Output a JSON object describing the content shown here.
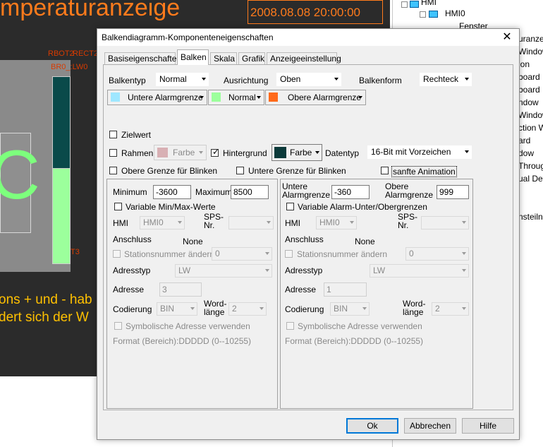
{
  "background_app": {
    "title": "mperaturanzeige",
    "datetime": "2008.08.08  20:00:00",
    "big_letter": "C",
    "red_labels": [
      "RBOT2",
      "RECT2",
      "BR0_:LW0",
      "T3"
    ],
    "yellow_text": [
      "ons + und - hab",
      "dert sich der W"
    ],
    "tree": {
      "hmi_root": "HMI",
      "hmi0": "HMI0",
      "fenster": "Fenster",
      "items": [
        "uranzeig",
        "Window",
        "ion",
        "board",
        "board",
        "ndow",
        "Window",
        "ction W",
        "ard",
        "dow",
        "Through",
        "ual Devi",
        "nsteilne"
      ]
    }
  },
  "dialog": {
    "title": "Balkendiagramm-Komponenteneigenschaften",
    "close_glyph": "✕",
    "tabs": [
      "Basiseigenschaften",
      "Balken",
      "Skala",
      "Grafik",
      "Anzeigeeinstellung"
    ],
    "active_tab": 1,
    "row1": {
      "balkentyp_label": "Balkentyp",
      "balkentyp_value": "Normal",
      "ausrichtung_label": "Ausrichtung",
      "ausrichtung_value": "Oben",
      "balkenform_label": "Balkenform",
      "balkenform_value": "Rechteck"
    },
    "colors": [
      {
        "label": "Untere Alarmgrenze",
        "color": "#9fe7ff"
      },
      {
        "label": "Normal",
        "color": "#9cff9c"
      },
      {
        "label": "Obere Alarmgrenze",
        "color": "#ff6a1a"
      }
    ],
    "zielwert": "Zielwert",
    "rahmen": "Rahmen",
    "rahmen_farbe": "Farbe",
    "rahmen_color": "#d8b0b4",
    "hintergrund": "Hintergrund",
    "hintergrund_farbe": "Farbe",
    "hintergrund_color": "#0b3a3a",
    "datentyp_label": "Datentyp",
    "datentyp_value": "16-Bit mit Vorzeichen",
    "obere_blinken": "Obere Grenze für Blinken",
    "untere_blinken": "Untere Grenze für Blinken",
    "sanfte_animation": "sanfte Animation",
    "left_group": {
      "minimum_label": "Minimum",
      "minimum_value": "-3600",
      "maximum_label": "Maximum",
      "maximum_value": "8500",
      "variable_check": "Variable Min/Max-Werte",
      "hmi_label": "HMI",
      "hmi_value": "HMI0",
      "sps_label": "SPS-\nNr.",
      "sps_value": "",
      "anschluss_label": "Anschluss",
      "anschluss_value": "None",
      "station_label": "Stationsnummer ändern",
      "station_value": "0",
      "adresstyp_label": "Adresstyp",
      "adresstyp_value": "LW",
      "adresse_label": "Adresse",
      "adresse_value": "3",
      "codierung_label": "Codierung",
      "codierung_value": "BIN",
      "wordlaenge_label": "Word-\nlänge",
      "wordlaenge_value": "2",
      "symbolisch_label": "Symbolische Adresse verwenden",
      "format_label": "Format (Bereich):DDDDD (0--10255)"
    },
    "right_group": {
      "untere_label": "Untere\nAlarmgrenze",
      "untere_value": "-360",
      "obere_label": "Obere\nAlarmgrenze",
      "obere_value": "999",
      "variable_check": "Variable Alarm-Unter/Obergrenzen",
      "hmi_label": "HMI",
      "hmi_value": "HMI0",
      "sps_label": "SPS-\nNr.",
      "sps_value": "",
      "anschluss_label": "Anschluss",
      "anschluss_value": "None",
      "station_label": "Stationsnummer ändern",
      "station_value": "0",
      "adresstyp_label": "Adresstyp",
      "adresstyp_value": "LW",
      "adresse_label": "Adresse",
      "adresse_value": "1",
      "codierung_label": "Codierung",
      "codierung_value": "BIN",
      "wordlaenge_label": "Word-\nlänge",
      "wordlaenge_value": "2",
      "symbolisch_label": "Symbolische Adresse verwenden",
      "format_label": "Format (Bereich):DDDDD (0--10255)"
    },
    "buttons": {
      "ok": "Ok",
      "abbrechen": "Abbrechen",
      "hilfe": "Hilfe"
    }
  }
}
